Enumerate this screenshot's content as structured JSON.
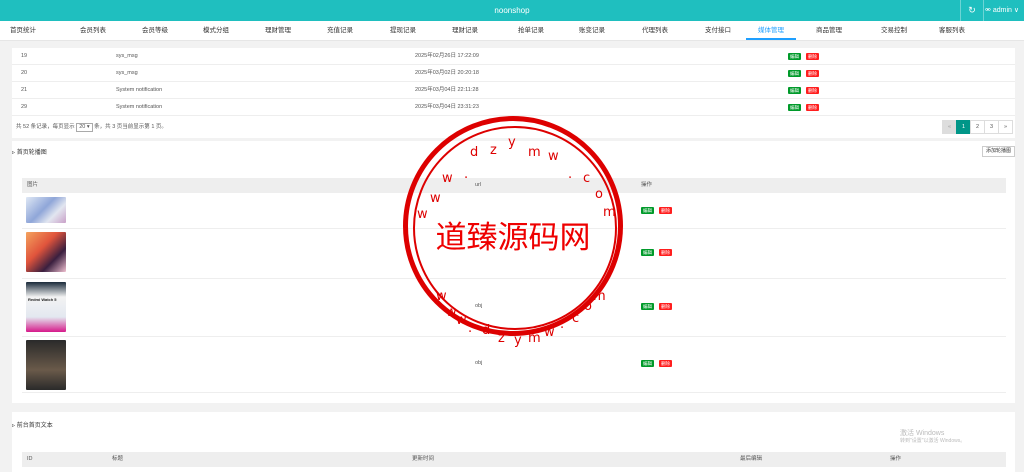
{
  "app": {
    "title": "noonshop",
    "refresh_icon": "refresh-icon",
    "user_label": "admin ∨",
    "user_icon": "user-icon"
  },
  "nav": [
    {
      "label": "首页统计"
    },
    {
      "label": "会员列表"
    },
    {
      "label": "会员等级"
    },
    {
      "label": "模式分组"
    },
    {
      "label": "理财管理"
    },
    {
      "label": "充值记录"
    },
    {
      "label": "提现记录"
    },
    {
      "label": "理财记录"
    },
    {
      "label": "抢单记录"
    },
    {
      "label": "账变记录"
    },
    {
      "label": "代理列表"
    },
    {
      "label": "支付接口"
    },
    {
      "label": "媒体管理",
      "active": true
    },
    {
      "label": "商品管理"
    },
    {
      "label": "交易控制"
    },
    {
      "label": "客服列表"
    }
  ],
  "messages": {
    "rows": [
      {
        "id": "19",
        "type": "sys_msg",
        "time": "2025年02月26日 17:22:09"
      },
      {
        "id": "20",
        "type": "sys_msg",
        "time": "2025年03月02日 20:20:18"
      },
      {
        "id": "21",
        "type": "System notification",
        "time": "2025年03月04日 22:11:28"
      },
      {
        "id": "29",
        "type": "System notification",
        "time": "2025年03月04日 23:31:23"
      }
    ],
    "edit_label": "编辑",
    "delete_label": "删除",
    "pager_prefix": "共 52 条记录，每页显示",
    "per_page": "20",
    "pager_suffix": "条，共 3 页当前显示第 1 页。",
    "pages": [
      "«",
      "1",
      "2",
      "3",
      "»"
    ]
  },
  "banner_section": {
    "title": "首页轮播图",
    "add_button": "添加轮播图",
    "headers": {
      "image": "图片",
      "url": "url",
      "action": "操作"
    },
    "rows": [
      {
        "url": "",
        "image": "image-1"
      },
      {
        "url": "",
        "image": "image-2"
      },
      {
        "url": "obj",
        "image": "image-3"
      },
      {
        "url": "obj",
        "image": "image-4"
      }
    ],
    "thumb3_text": "Redmi Watch 5"
  },
  "text_section": {
    "title": "前台首页文本",
    "headers": {
      "id": "ID",
      "title": "标题",
      "update_time": "更新时间",
      "last_editor": "最后编辑",
      "action": "操作"
    }
  },
  "watermark": {
    "big_text": "道臻源码网",
    "url_letters": "wwwdzymwcom"
  },
  "windows_activation": {
    "line1": "激活 Windows",
    "line2": "转到\"设置\"以激活 Windows。"
  },
  "colors": {
    "topbar": "#1fbfbf",
    "active_tab": "#1e9fff",
    "edit": "#009a2a",
    "delete": "#ff1e1e",
    "page_active": "#009688",
    "watermark": "#dd0000"
  }
}
